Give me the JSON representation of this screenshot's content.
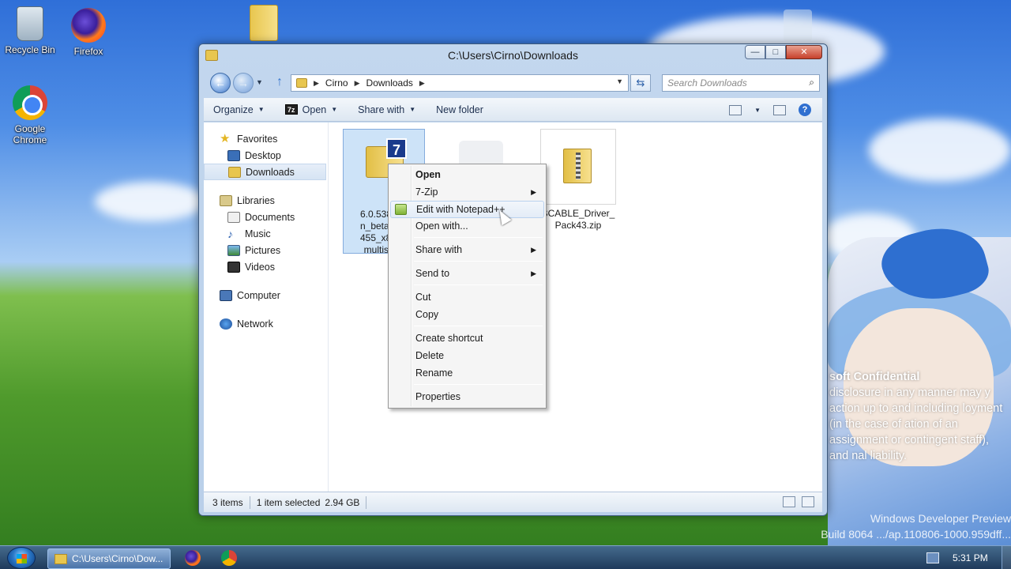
{
  "desktop": {
    "icons": [
      {
        "label": "Recycle Bin",
        "icon": "recycle-bin-icon"
      },
      {
        "label": "Firefox",
        "icon": "firefox-icon"
      },
      {
        "label": "Google Chrome",
        "icon": "chrome-icon"
      }
    ],
    "watermark": {
      "title": "soft Confidential",
      "body": "disclosure in any manner may y action up to and including loyment (in the case of ation of an assignment or contingent staff), and nal liability."
    },
    "build": {
      "line1": "Windows Developer Preview",
      "line2": "Build 8064 .../ap.110806-1000.959dff..."
    }
  },
  "window": {
    "title": "C:\\Users\\Cirno\\Downloads",
    "buttons": {
      "minimize": "—",
      "maximize": "□",
      "close": "✕"
    },
    "address": {
      "crumbs": [
        "Cirno",
        "Downloads"
      ]
    },
    "search_placeholder": "Search Downloads",
    "toolbar": {
      "organize": "Organize",
      "open": "Open",
      "share_with": "Share with",
      "new_folder": "New folder"
    },
    "nav": {
      "favorites": "Favorites",
      "desktop": "Desktop",
      "downloads": "Downloads",
      "libraries": "Libraries",
      "documents": "Documents",
      "music": "Music",
      "pictures": "Pictures",
      "videos": "Videos",
      "computer": "Computer",
      "network": "Network"
    },
    "files": [
      {
        "name": "6.0.5384.4.\nn_beta2.06\n455_x86fre\nmultisku_",
        "line1": "6.0.5384.4.",
        "line2": "n_beta2.06",
        "line3": "455_x86fre",
        "line4": "multisku_",
        "selected": true
      },
      {
        "name": "",
        "selected": false
      },
      {
        "name": "BCABLE_Driver_Pack43.zip",
        "line1": "BCABLE_Driver_",
        "line2": "Pack43.zip",
        "selected": false
      }
    ],
    "status": {
      "items": "3 items",
      "selected": "1 item selected",
      "size": "2.94 GB"
    }
  },
  "context_menu": {
    "open": "Open",
    "seven_zip": "7-Zip",
    "edit_notepad": "Edit with Notepad++",
    "open_with": "Open with...",
    "share_with": "Share with",
    "send_to": "Send to",
    "cut": "Cut",
    "copy": "Copy",
    "create_shortcut": "Create shortcut",
    "delete": "Delete",
    "rename": "Rename",
    "properties": "Properties"
  },
  "taskbar": {
    "explorer_label": "C:\\Users\\Cirno\\Dow...",
    "clock": "5:31 PM"
  }
}
